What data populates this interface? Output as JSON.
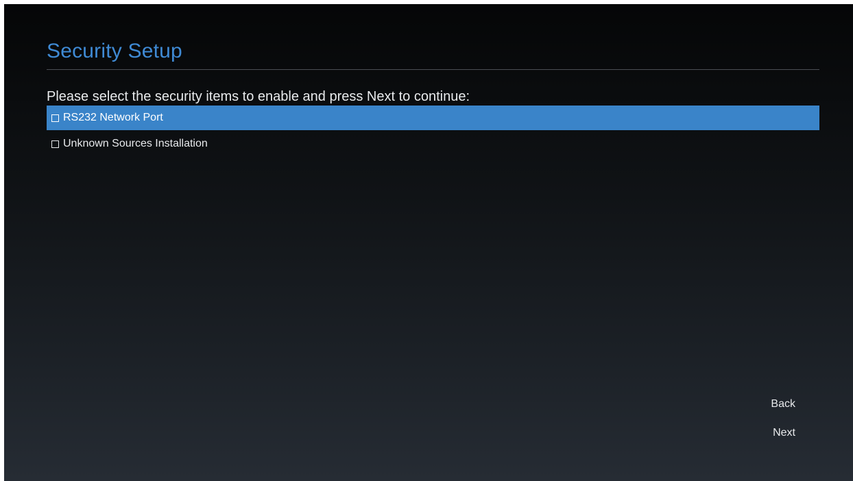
{
  "page": {
    "title": "Security Setup",
    "instructions": "Please select the security items to enable and press Next to continue:"
  },
  "options": [
    {
      "label": "RS232 Network Port",
      "checked": false,
      "selected": true
    },
    {
      "label": "Unknown Sources Installation",
      "checked": false,
      "selected": false
    }
  ],
  "nav": {
    "back_label": "Back",
    "next_label": "Next"
  },
  "colors": {
    "accent": "#3f8ad4",
    "selection": "#3a84c9"
  }
}
